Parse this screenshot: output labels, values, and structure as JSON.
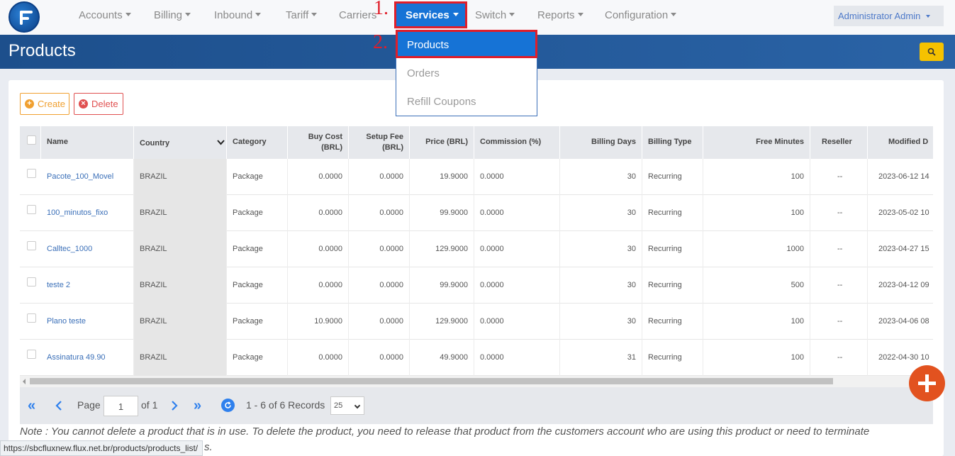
{
  "nav": {
    "items": [
      "Accounts",
      "Billing",
      "Inbound",
      "Tariff",
      "Carriers",
      "Switch",
      "Reports",
      "Configuration"
    ],
    "active": "Services",
    "user": "Administrator Admin"
  },
  "annotations": {
    "step1": "1.",
    "step2": "2."
  },
  "services_menu": [
    "Products",
    "Orders",
    "Refill Coupons"
  ],
  "page": {
    "title": "Products"
  },
  "actions": {
    "create": "Create",
    "delete": "Delete"
  },
  "table": {
    "headers": {
      "name": "Name",
      "country": "Country",
      "category": "Category",
      "buy_cost": "Buy Cost",
      "buy_cost_unit": "(BRL)",
      "setup_fee": "Setup Fee",
      "setup_fee_unit": "(BRL)",
      "price": "Price (BRL)",
      "commission": "Commission (%)",
      "billing_days": "Billing Days",
      "billing_type": "Billing Type",
      "free_minutes": "Free Minutes",
      "reseller": "Reseller",
      "modified": "Modified D"
    },
    "rows": [
      {
        "name": "Pacote_100_Movel",
        "country": "BRAZIL",
        "category": "Package",
        "buy_cost": "0.0000",
        "setup_fee": "0.0000",
        "price": "19.9000",
        "commission": "0.0000",
        "billing_days": "30",
        "billing_type": "Recurring",
        "free_minutes": "100",
        "reseller": "--",
        "modified": "2023-06-12 14"
      },
      {
        "name": "100_minutos_fixo",
        "country": "BRAZIL",
        "category": "Package",
        "buy_cost": "0.0000",
        "setup_fee": "0.0000",
        "price": "99.9000",
        "commission": "0.0000",
        "billing_days": "30",
        "billing_type": "Recurring",
        "free_minutes": "100",
        "reseller": "--",
        "modified": "2023-05-02 10"
      },
      {
        "name": "Calltec_1000",
        "country": "BRAZIL",
        "category": "Package",
        "buy_cost": "0.0000",
        "setup_fee": "0.0000",
        "price": "129.9000",
        "commission": "0.0000",
        "billing_days": "30",
        "billing_type": "Recurring",
        "free_minutes": "1000",
        "reseller": "--",
        "modified": "2023-04-27 15"
      },
      {
        "name": "teste 2",
        "country": "BRAZIL",
        "category": "Package",
        "buy_cost": "0.0000",
        "setup_fee": "0.0000",
        "price": "99.9000",
        "commission": "0.0000",
        "billing_days": "30",
        "billing_type": "Recurring",
        "free_minutes": "500",
        "reseller": "--",
        "modified": "2023-04-12 09"
      },
      {
        "name": "Plano teste",
        "country": "BRAZIL",
        "category": "Package",
        "buy_cost": "10.9000",
        "setup_fee": "0.0000",
        "price": "129.9000",
        "commission": "0.0000",
        "billing_days": "30",
        "billing_type": "Recurring",
        "free_minutes": "100",
        "reseller": "--",
        "modified": "2023-04-06 08"
      },
      {
        "name": "Assinatura 49.90",
        "country": "BRAZIL",
        "category": "Package",
        "buy_cost": "0.0000",
        "setup_fee": "0.0000",
        "price": "49.9000",
        "commission": "0.0000",
        "billing_days": "31",
        "billing_type": "Recurring",
        "free_minutes": "100",
        "reseller": "--",
        "modified": "2022-04-30 10"
      }
    ]
  },
  "pager": {
    "page_label": "Page",
    "page_value": "1",
    "of_label": "of 1",
    "records": "1 - 6 of 6 Records",
    "per_page": "25"
  },
  "note": "Note : You cannot delete a product that is in use. To delete the product, you need to release that product from the customers account who are using this product or need to terminate",
  "statusbar": {
    "url": "https://sbcfluxnew.flux.net.br/products/products_list/",
    "trailing": "s."
  }
}
